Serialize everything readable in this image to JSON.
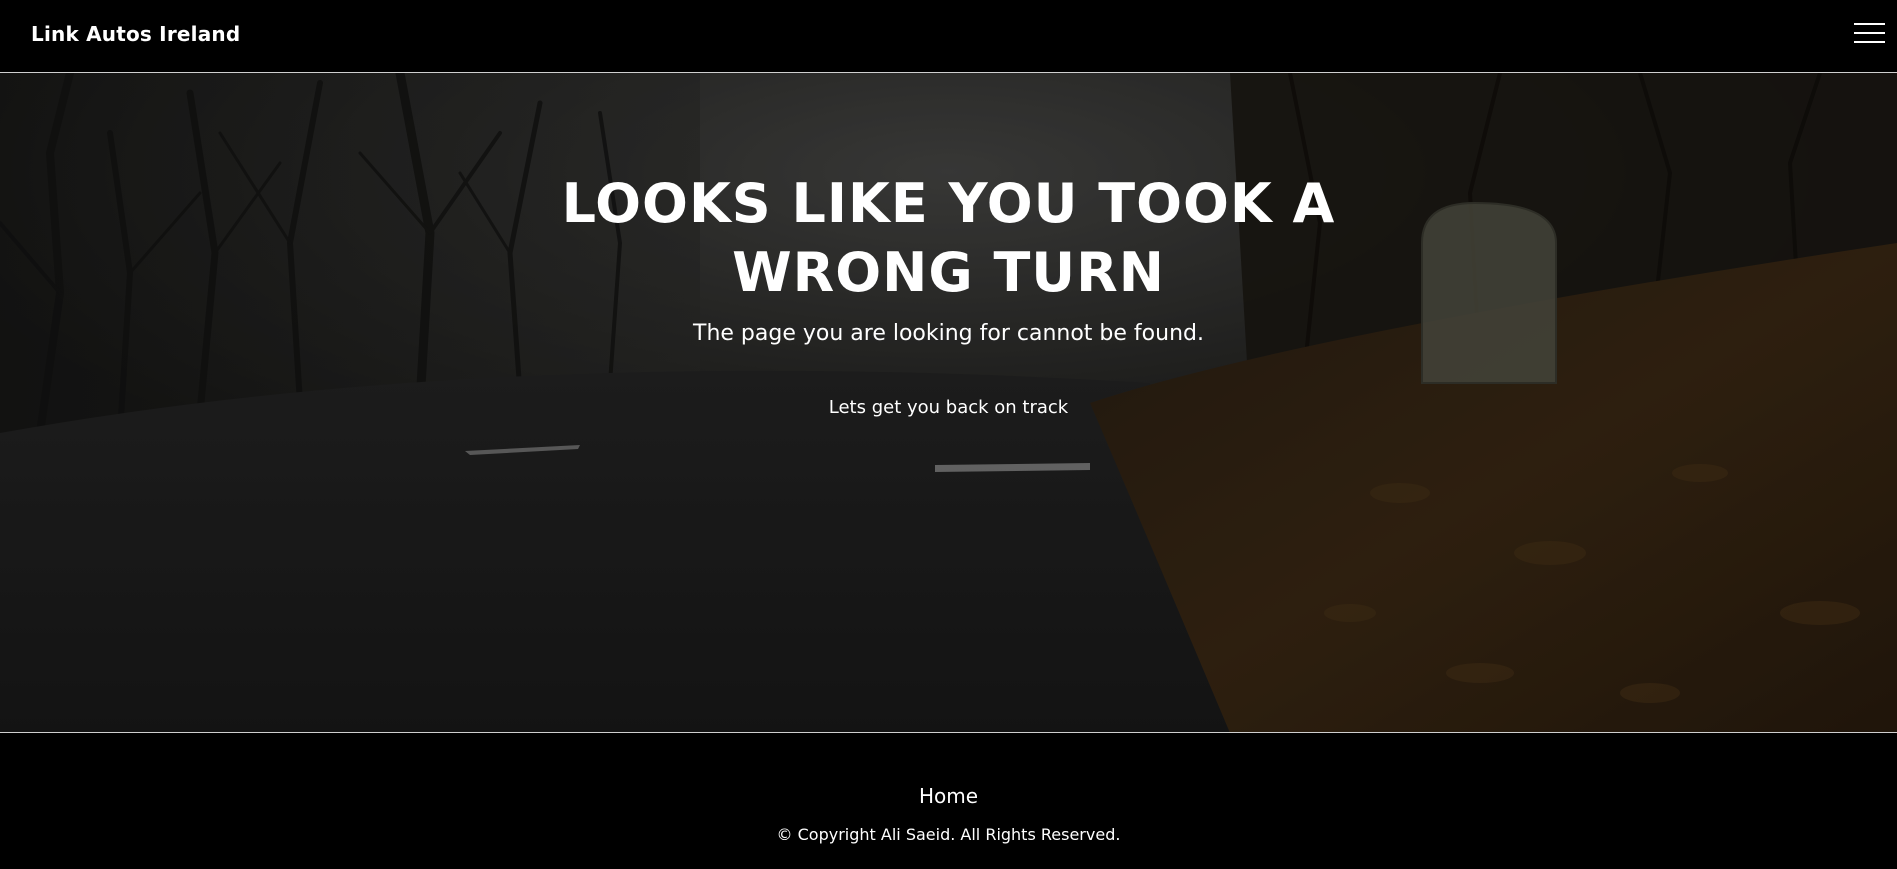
{
  "header": {
    "brand": "Link Autos Ireland",
    "menu_icon": "hamburger-menu-icon"
  },
  "hero": {
    "headline_line1": "LOOKS LIKE YOU TOOK A",
    "headline_line2": "WRONG TURN",
    "subheadline": "The page you are looking for cannot be found.",
    "back_link": "Lets get you back on track",
    "background": "dark foggy road with autumn leaves and milestone"
  },
  "footer": {
    "home_link": "Home",
    "copyright": "© Copyright Ali Saeid. All Rights Reserved."
  },
  "colors": {
    "bar_background": "#000000",
    "text": "#ffffff",
    "divider": "#cfcfcf"
  }
}
